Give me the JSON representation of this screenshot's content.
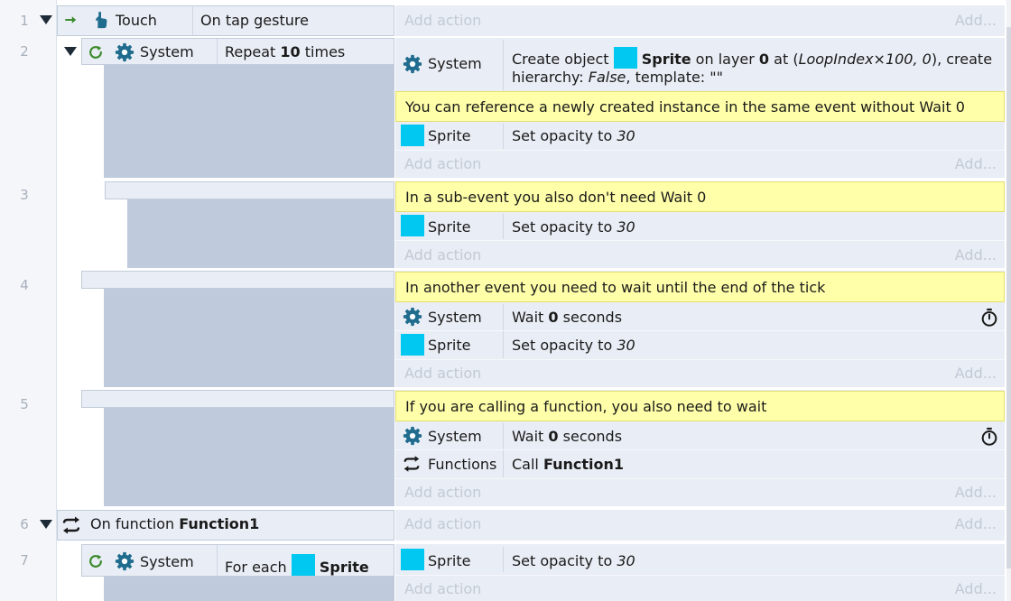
{
  "colors": {
    "sprite": "#00c8f0",
    "comment_bg": "#ffffaa",
    "condition_bg": "#e9edf5",
    "block_body": "#bfcadd",
    "system_icon": "#1f6c8e",
    "loop_icon": "#3a8a2a"
  },
  "common": {
    "add_action": "Add action",
    "add_more": "Add...",
    "system": "System",
    "sprite": "Sprite",
    "functions": "Functions",
    "set_opacity_prefix": "Set opacity to ",
    "opacity_value": "30",
    "wait_prefix": "Wait ",
    "wait_value": "0",
    "wait_suffix": " seconds"
  },
  "events": {
    "e1": {
      "line": "1",
      "object": "Touch",
      "condition": "On tap gesture"
    },
    "e2": {
      "line": "2",
      "repeat_prefix": "Repeat ",
      "repeat_count": "10",
      "repeat_suffix": " times",
      "create": {
        "text1": "Create object ",
        "object": "Sprite",
        "text2": " on layer ",
        "layer": "0",
        "text3": " at (",
        "coords": "LoopIndex×100, 0",
        "text4": "), create",
        "text5": "hierarchy: ",
        "hierarchy": "False",
        "text6": ", template: \"\""
      },
      "comment": "You can reference a newly created instance in the same event without Wait 0"
    },
    "e3": {
      "line": "3",
      "comment": "In a sub-event you also don't need Wait 0"
    },
    "e4": {
      "line": "4",
      "comment": "In another event you need to wait until the end of the tick"
    },
    "e5": {
      "line": "5",
      "comment": "If you are calling a function, you also need to wait",
      "call_prefix": "Call ",
      "call_name": "Function1"
    },
    "e6": {
      "line": "6",
      "prefix": "On function ",
      "name": "Function1"
    },
    "e7": {
      "line": "7",
      "foreach_prefix": "For each "
    }
  }
}
